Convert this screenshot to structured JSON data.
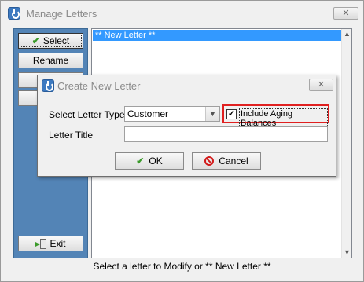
{
  "window": {
    "title": "Manage Letters",
    "close_glyph": "✕"
  },
  "sidebar": {
    "select_label": "Select",
    "select_mnemonic_rest": "elect",
    "rename_label": "Rename",
    "exit_label": "Exit"
  },
  "list": {
    "items": [
      "** New Letter **"
    ]
  },
  "status": {
    "text": "Select a letter to Modify or ** New Letter **"
  },
  "dialog": {
    "title": "Create New Letter",
    "close_glyph": "✕",
    "type_label": "Select Letter Type",
    "type_value": "Customer",
    "aging_label": "Include Aging Balances",
    "aging_checked": true,
    "title_label": "Letter Title",
    "title_value": "",
    "ok_label": "OK",
    "cancel_label": "Cancel"
  },
  "icons": {
    "app": "power-icon",
    "select": "checkmark-icon",
    "delete": "red-x-icon",
    "exit": "exit-door-icon",
    "ok": "checkmark-icon",
    "cancel": "no-entry-icon"
  },
  "colors": {
    "sidebar": "#5384b6",
    "selection": "#3399ff",
    "highlight_box": "#e02020"
  }
}
